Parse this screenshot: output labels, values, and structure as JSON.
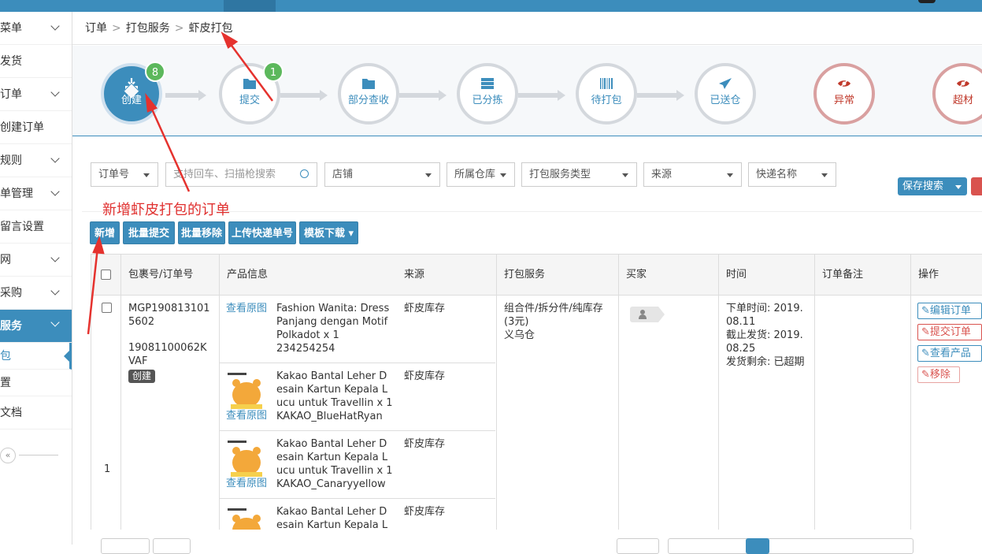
{
  "sidebar": {
    "items": [
      {
        "label": "菜单",
        "chevron": true
      },
      {
        "label": "发货",
        "chevron": false
      },
      {
        "label": "订单",
        "chevron": true
      },
      {
        "label": "创建订单",
        "chevron": false
      },
      {
        "label": "规则",
        "chevron": true
      },
      {
        "label": "单管理",
        "chevron": true
      },
      {
        "label": "留言设置",
        "chevron": false
      },
      {
        "label": "网",
        "chevron": true
      },
      {
        "label": "采购",
        "chevron": true
      }
    ],
    "active_group": "服务",
    "sub_items": [
      "包",
      "置"
    ],
    "after": "文档",
    "collapse": "«"
  },
  "breadcrumb": {
    "level1": "订单",
    "level2": "打包服务",
    "level3": "虾皮打包",
    "sep": ">"
  },
  "steps": [
    {
      "label": "创建",
      "badge": "8",
      "icon": "download-icon"
    },
    {
      "label": "提交",
      "badge": "1",
      "icon": "folder-icon"
    },
    {
      "label": "部分查收",
      "icon": "folder-icon"
    },
    {
      "label": "已分拣",
      "icon": "server-icon"
    },
    {
      "label": "待打包",
      "icon": "barcode-icon"
    },
    {
      "label": "已送仓",
      "icon": "send-icon"
    },
    {
      "label": "异常",
      "icon": "eye-slash-icon"
    },
    {
      "label": "超材",
      "icon": "eye-slash-icon"
    }
  ],
  "filters": {
    "order_no": "订单号",
    "search_placeholder": "支持回车、扫描枪搜索",
    "shop": "店铺",
    "warehouse": "所属仓库",
    "service_type": "打包服务类型",
    "source": "来源",
    "courier": "快递名称",
    "save_search": "保存搜索"
  },
  "annotation": "新增虾皮打包的订单",
  "toolbar": {
    "add": "新增",
    "batch_submit": "批量提交",
    "batch_remove": "批量移除",
    "upload_tracking": "上传快递单号",
    "template_download": "模板下载"
  },
  "table": {
    "headers": {
      "package_no": "包裹号/订单号",
      "product": "产品信息",
      "source": "来源",
      "service": "打包服务",
      "buyer": "买家",
      "time": "时间",
      "remark": "订单备注",
      "ops": "操作"
    },
    "row": {
      "index": "1",
      "package_no": "MGP1908131015602",
      "order_no": "19081100062KVAF",
      "status": "创建",
      "service": "组合件/拆分件/纯库存(3元)",
      "warehouse": "义乌仓",
      "time_order": "下单时间: 2019.08.11",
      "time_deadline": "截止发货: 2019.08.25",
      "time_left": "发货剩余: 已超期",
      "ops": {
        "edit": "编辑订单",
        "submit": "提交订单",
        "view": "查看产品",
        "remove": "移除"
      },
      "products": [
        {
          "view": "查看原图",
          "name": "Fashion Wanita: Dress Panjang dengan Motif Polkadot x 1",
          "sku": "234254254",
          "source": "虾皮库存",
          "thumb": false
        },
        {
          "view": "查看原图",
          "name": "Kakao Bantal Leher Desain Kartun Kepala Lucu untuk Travellin x 1",
          "sku": "KAKAO_BlueHatRyan",
          "source": "虾皮库存",
          "thumb": true
        },
        {
          "view": "查看原图",
          "name": "Kakao Bantal Leher Desain Kartun Kepala Lucu untuk Travellin x 1",
          "sku": "KAKAO_Canaryyellow",
          "source": "虾皮库存",
          "thumb": true
        },
        {
          "view": "",
          "name": "Kakao Bantal Leher Desain Kartun Kepala Lucu unt",
          "sku": "",
          "source": "虾皮库存",
          "thumb": true
        }
      ]
    }
  },
  "colors": {
    "primary": "#3c8dbc",
    "success": "#5cb85c",
    "danger": "#d9534f",
    "annotation": "#e0302f"
  }
}
